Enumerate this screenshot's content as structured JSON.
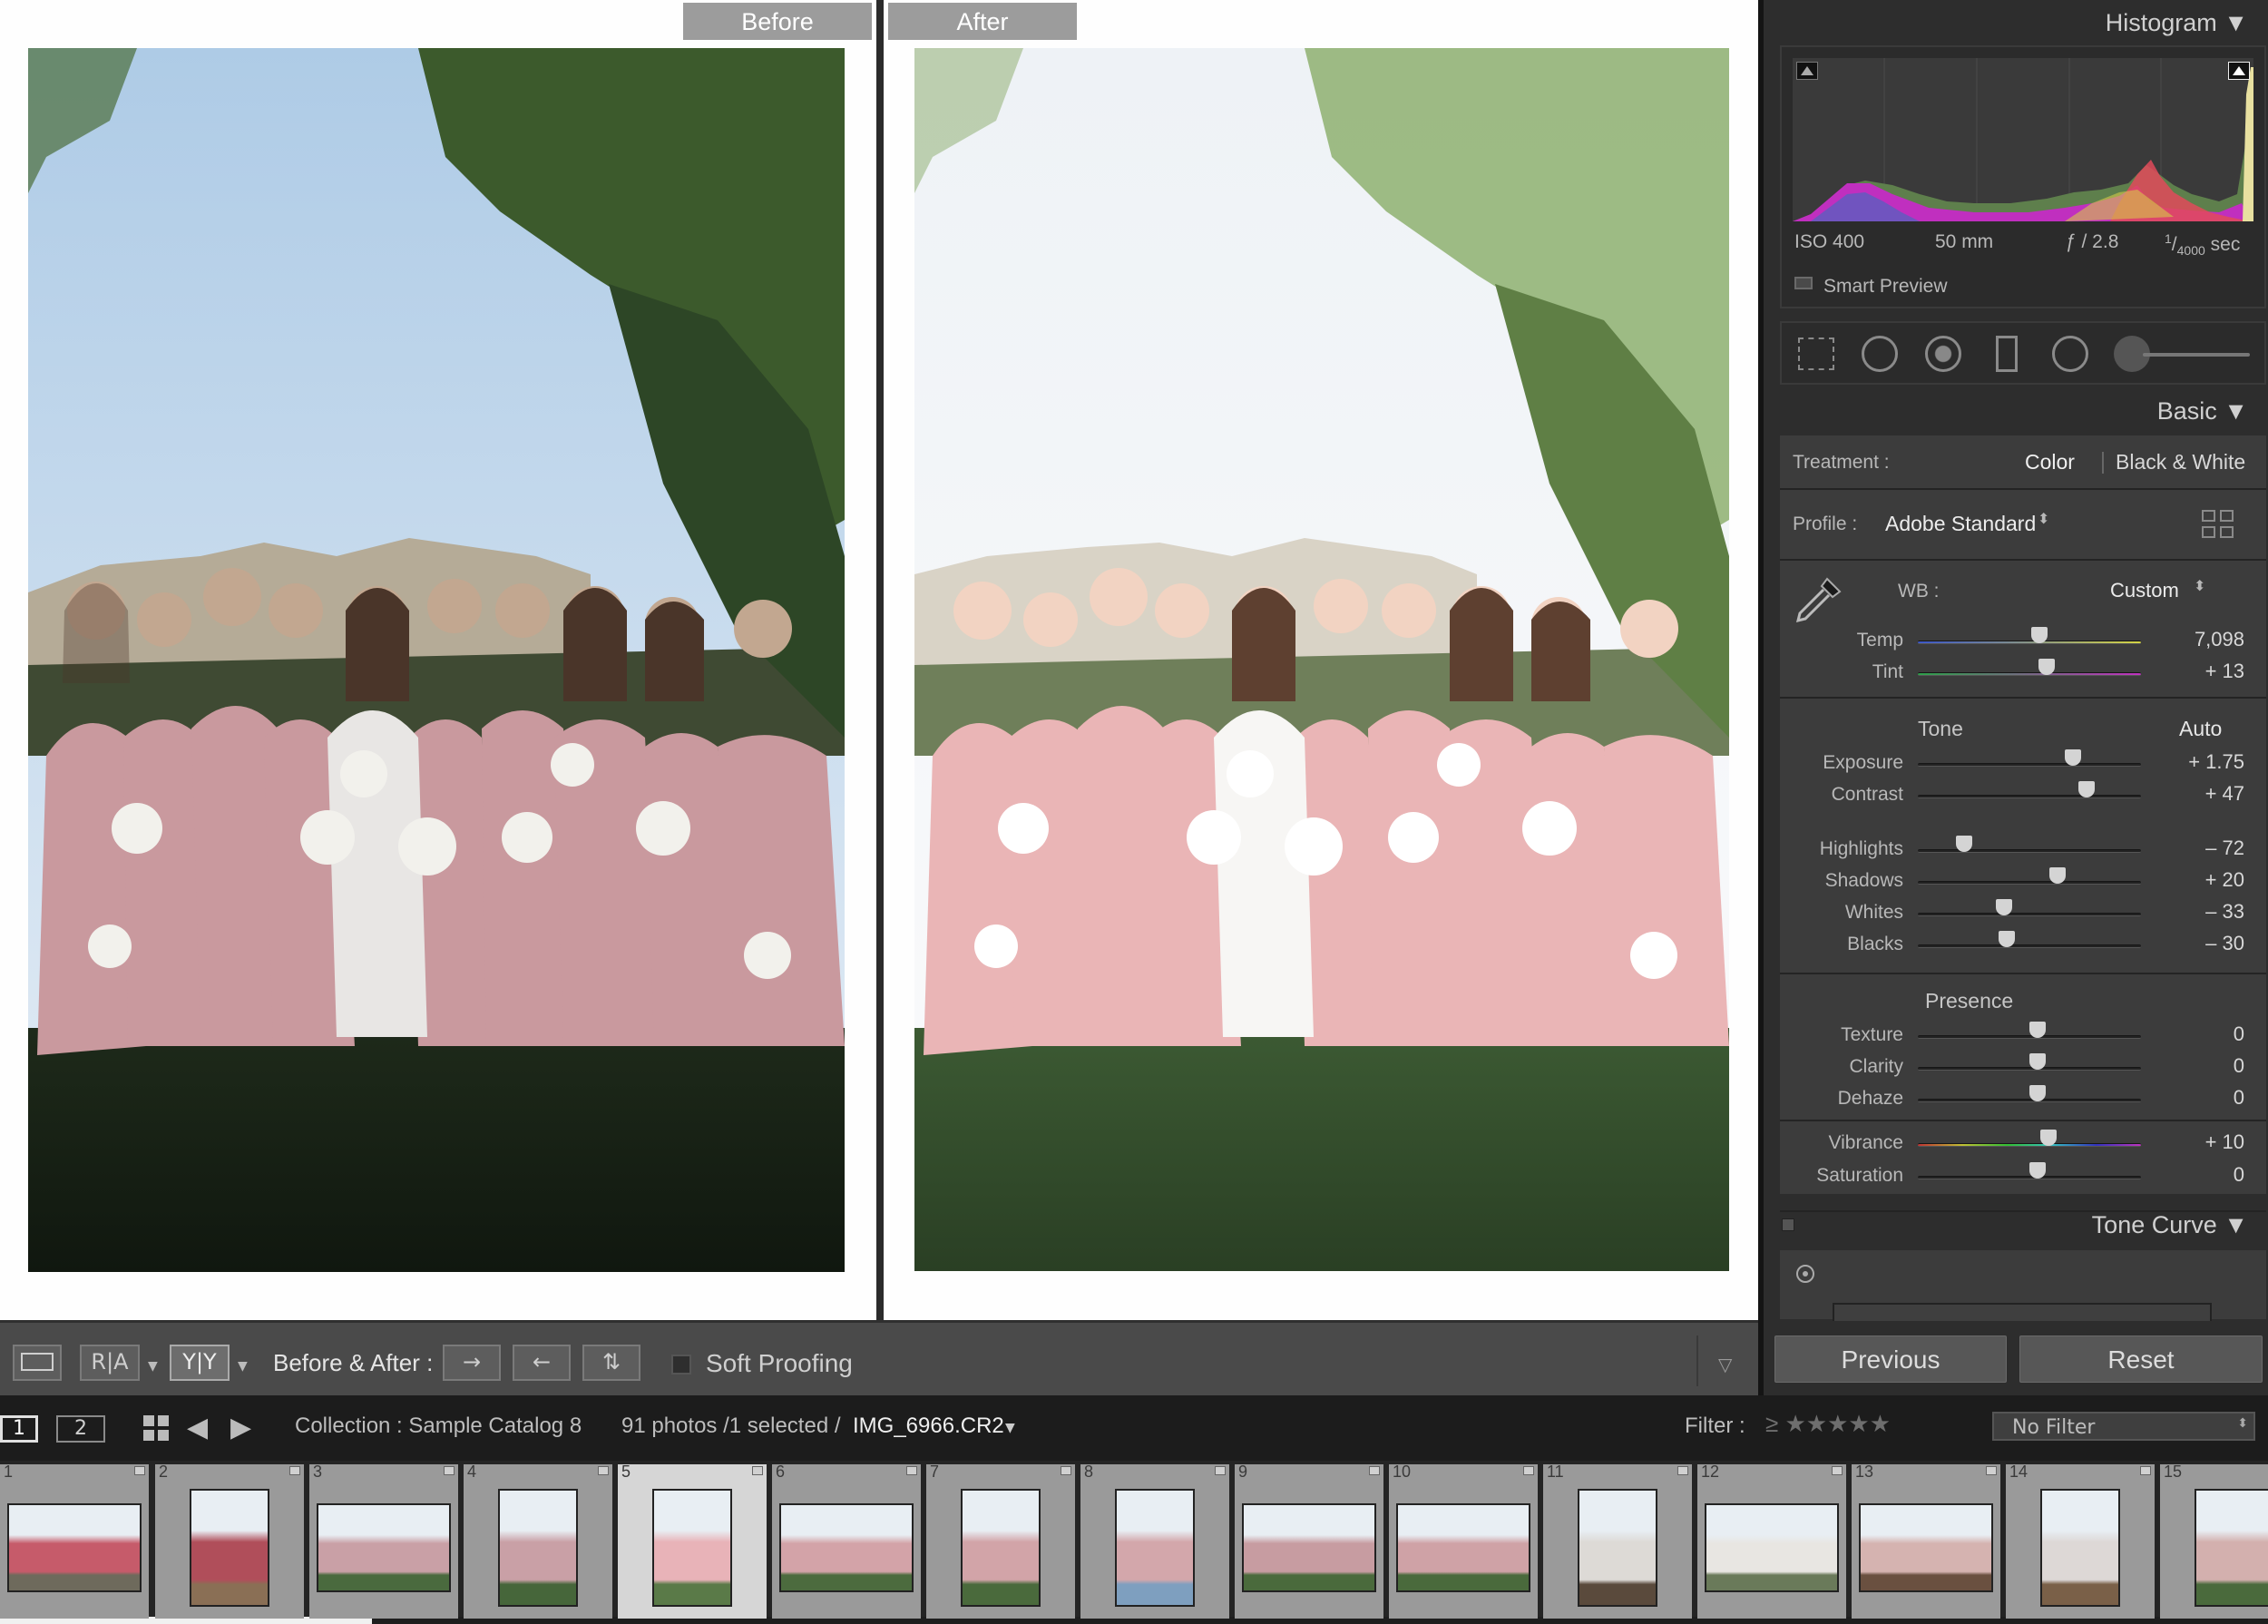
{
  "before_after": {
    "before_label": "Before",
    "after_label": "After"
  },
  "histogram": {
    "title": "Histogram",
    "iso": "ISO 400",
    "focal": "50 mm",
    "aperture": "ƒ / 2.8",
    "shutter_num": "1",
    "shutter_den": "4000",
    "shutter_unit": "sec",
    "smart_preview": "Smart Preview"
  },
  "basic": {
    "title": "Basic",
    "treatment_label": "Treatment :",
    "treatment_color": "Color",
    "treatment_bw": "Black & White",
    "profile_label": "Profile :",
    "profile_value": "Adobe Standard",
    "wb_label": "WB :",
    "wb_value": "Custom",
    "tone_label": "Tone",
    "auto_label": "Auto",
    "presence_label": "Presence",
    "sliders": [
      {
        "label": "Temp",
        "value": "7,098",
        "pos": 0.51
      },
      {
        "label": "Tint",
        "value": "+ 13",
        "pos": 0.54
      },
      {
        "label": "Exposure",
        "value": "+ 1.75",
        "pos": 0.66
      },
      {
        "label": "Contrast",
        "value": "+ 47",
        "pos": 0.72
      },
      {
        "label": "Highlights",
        "value": "– 72",
        "pos": 0.17
      },
      {
        "label": "Shadows",
        "value": "+ 20",
        "pos": 0.59
      },
      {
        "label": "Whites",
        "value": "– 33",
        "pos": 0.35
      },
      {
        "label": "Blacks",
        "value": "– 30",
        "pos": 0.36
      },
      {
        "label": "Texture",
        "value": "0",
        "pos": 0.5
      },
      {
        "label": "Clarity",
        "value": "0",
        "pos": 0.5
      },
      {
        "label": "Dehaze",
        "value": "0",
        "pos": 0.5
      },
      {
        "label": "Vibrance",
        "value": "+ 10",
        "pos": 0.55
      },
      {
        "label": "Saturation",
        "value": "0",
        "pos": 0.5
      }
    ]
  },
  "tone_curve": {
    "title": "Tone Curve"
  },
  "buttons": {
    "previous": "Previous",
    "reset": "Reset"
  },
  "toolbar": {
    "before_after_label": "Before & After :",
    "soft_proofing": "Soft Proofing",
    "ra_label": "R|A",
    "yy_label": "Y|Y"
  },
  "filmbar": {
    "screen1": "1",
    "screen2": "2",
    "collection": "Collection : Sample Catalog 8",
    "photos": "91 photos /1 selected /",
    "filename": "IMG_6966.CR2",
    "filter_label": "Filter :",
    "no_filter": "No Filter"
  },
  "filmstrip": {
    "numbers": [
      "1",
      "2",
      "3",
      "4",
      "5",
      "6",
      "7",
      "8",
      "9",
      "10",
      "11",
      "12",
      "13",
      "14",
      "15"
    ],
    "selected_index": 5
  },
  "colors": {
    "panel_bg": "#2d2d2d",
    "panel_box": "#3c3c3c",
    "selected_cell": "#d6d6d6",
    "dress_pink": "#e0a9ad"
  }
}
